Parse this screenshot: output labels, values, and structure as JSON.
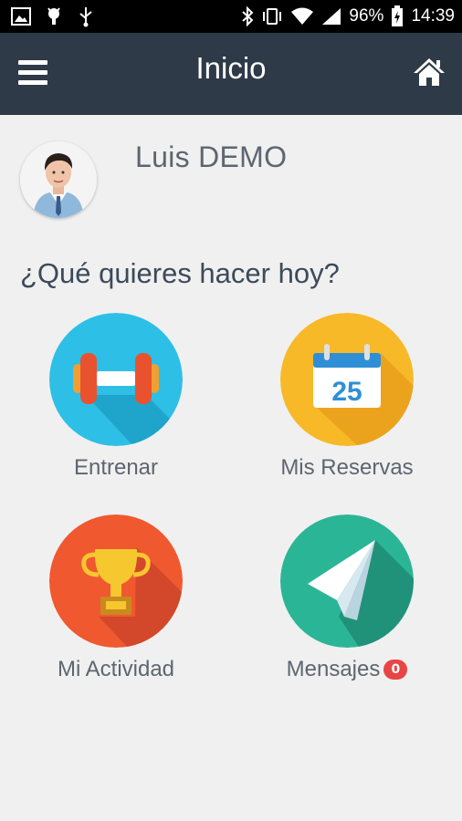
{
  "status_bar": {
    "battery": "96%",
    "time": "14:39"
  },
  "header": {
    "title": "Inicio"
  },
  "user": {
    "name": "Luis DEMO"
  },
  "prompt": "¿Qué quieres hacer hoy?",
  "tiles": [
    {
      "label": "Entrenar",
      "icon": "dumbbell-icon",
      "color": "#2ebfe6"
    },
    {
      "label": "Mis Reservas",
      "icon": "calendar-icon",
      "color": "#f7b928",
      "calendar_day": "25"
    },
    {
      "label": "Mi Actividad",
      "icon": "trophy-icon",
      "color": "#f0582f"
    },
    {
      "label": "Mensajes",
      "icon": "paper-plane-icon",
      "color": "#2bb597",
      "badge": "0"
    }
  ]
}
